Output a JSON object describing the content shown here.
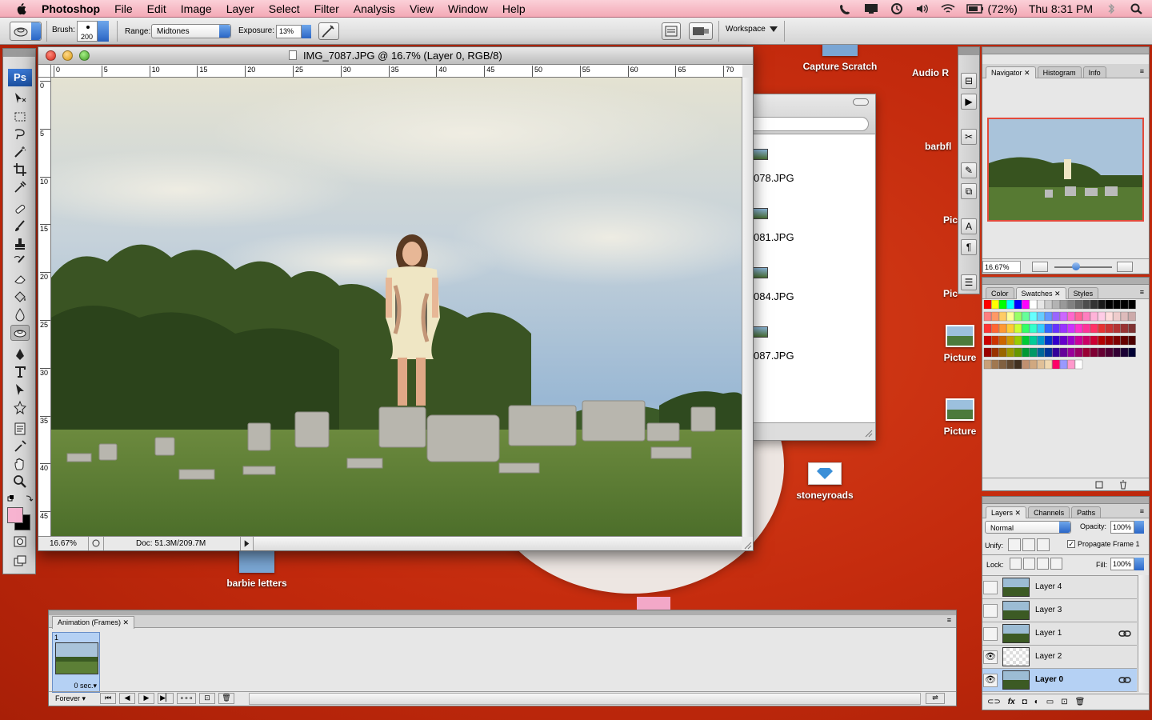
{
  "menubar": {
    "app_name": "Photoshop",
    "items": [
      "File",
      "Edit",
      "Image",
      "Layer",
      "Select",
      "Filter",
      "Analysis",
      "View",
      "Window",
      "Help"
    ],
    "battery": "(72%)",
    "clock": "Thu 8:31 PM"
  },
  "options": {
    "brush_label": "Brush:",
    "brush_size": "200",
    "range_label": "Range:",
    "range_value": "Midtones",
    "exposure_label": "Exposure:",
    "exposure_value": "13%",
    "workspace_label": "Workspace"
  },
  "document": {
    "title": "IMG_7087.JPG @ 16.7% (Layer 0, RGB/8)",
    "zoom": "16.67%",
    "doc_info": "Doc: 51.3M/209.7M",
    "ruler_h": [
      "0",
      "5",
      "10",
      "15",
      "20",
      "25",
      "30",
      "35",
      "40",
      "45",
      "50",
      "55",
      "60",
      "65",
      "70"
    ],
    "ruler_v": [
      "0",
      "5",
      "10",
      "15",
      "20",
      "25",
      "30",
      "35",
      "40",
      "45"
    ]
  },
  "finder": {
    "files": [
      "078.JPG",
      "081.JPG",
      "084.JPG",
      "087.JPG"
    ]
  },
  "desktop": {
    "icons": {
      "capture_scratch": "Capture Scratch",
      "audio": "Audio R",
      "barbfl": "barbfl",
      "pic1": "Pic",
      "pic2": "Pic",
      "picture1": "Picture",
      "picture2": "Picture",
      "stoneyroads": "stoneyroads",
      "barbie_letters": "barbie letters"
    }
  },
  "navigator": {
    "tabs": [
      "Navigator",
      "Histogram",
      "Info"
    ],
    "zoom": "16.67%"
  },
  "swatches": {
    "tabs": [
      "Color",
      "Swatches",
      "Styles"
    ]
  },
  "layers": {
    "tabs": [
      "Layers",
      "Channels",
      "Paths"
    ],
    "blend_mode": "Normal",
    "opacity_label": "Opacity:",
    "opacity": "100%",
    "unify_label": "Unify:",
    "propagate_label": "Propagate Frame 1",
    "lock_label": "Lock:",
    "fill_label": "Fill:",
    "fill": "100%",
    "rows": [
      {
        "name": "Layer 4"
      },
      {
        "name": "Layer 3"
      },
      {
        "name": "Layer 1"
      },
      {
        "name": "Layer 2"
      },
      {
        "name": "Layer 0"
      }
    ]
  },
  "animation": {
    "tab": "Animation (Frames)",
    "frame_number": "1",
    "frame_delay": "0 sec.",
    "loop": "Forever"
  }
}
